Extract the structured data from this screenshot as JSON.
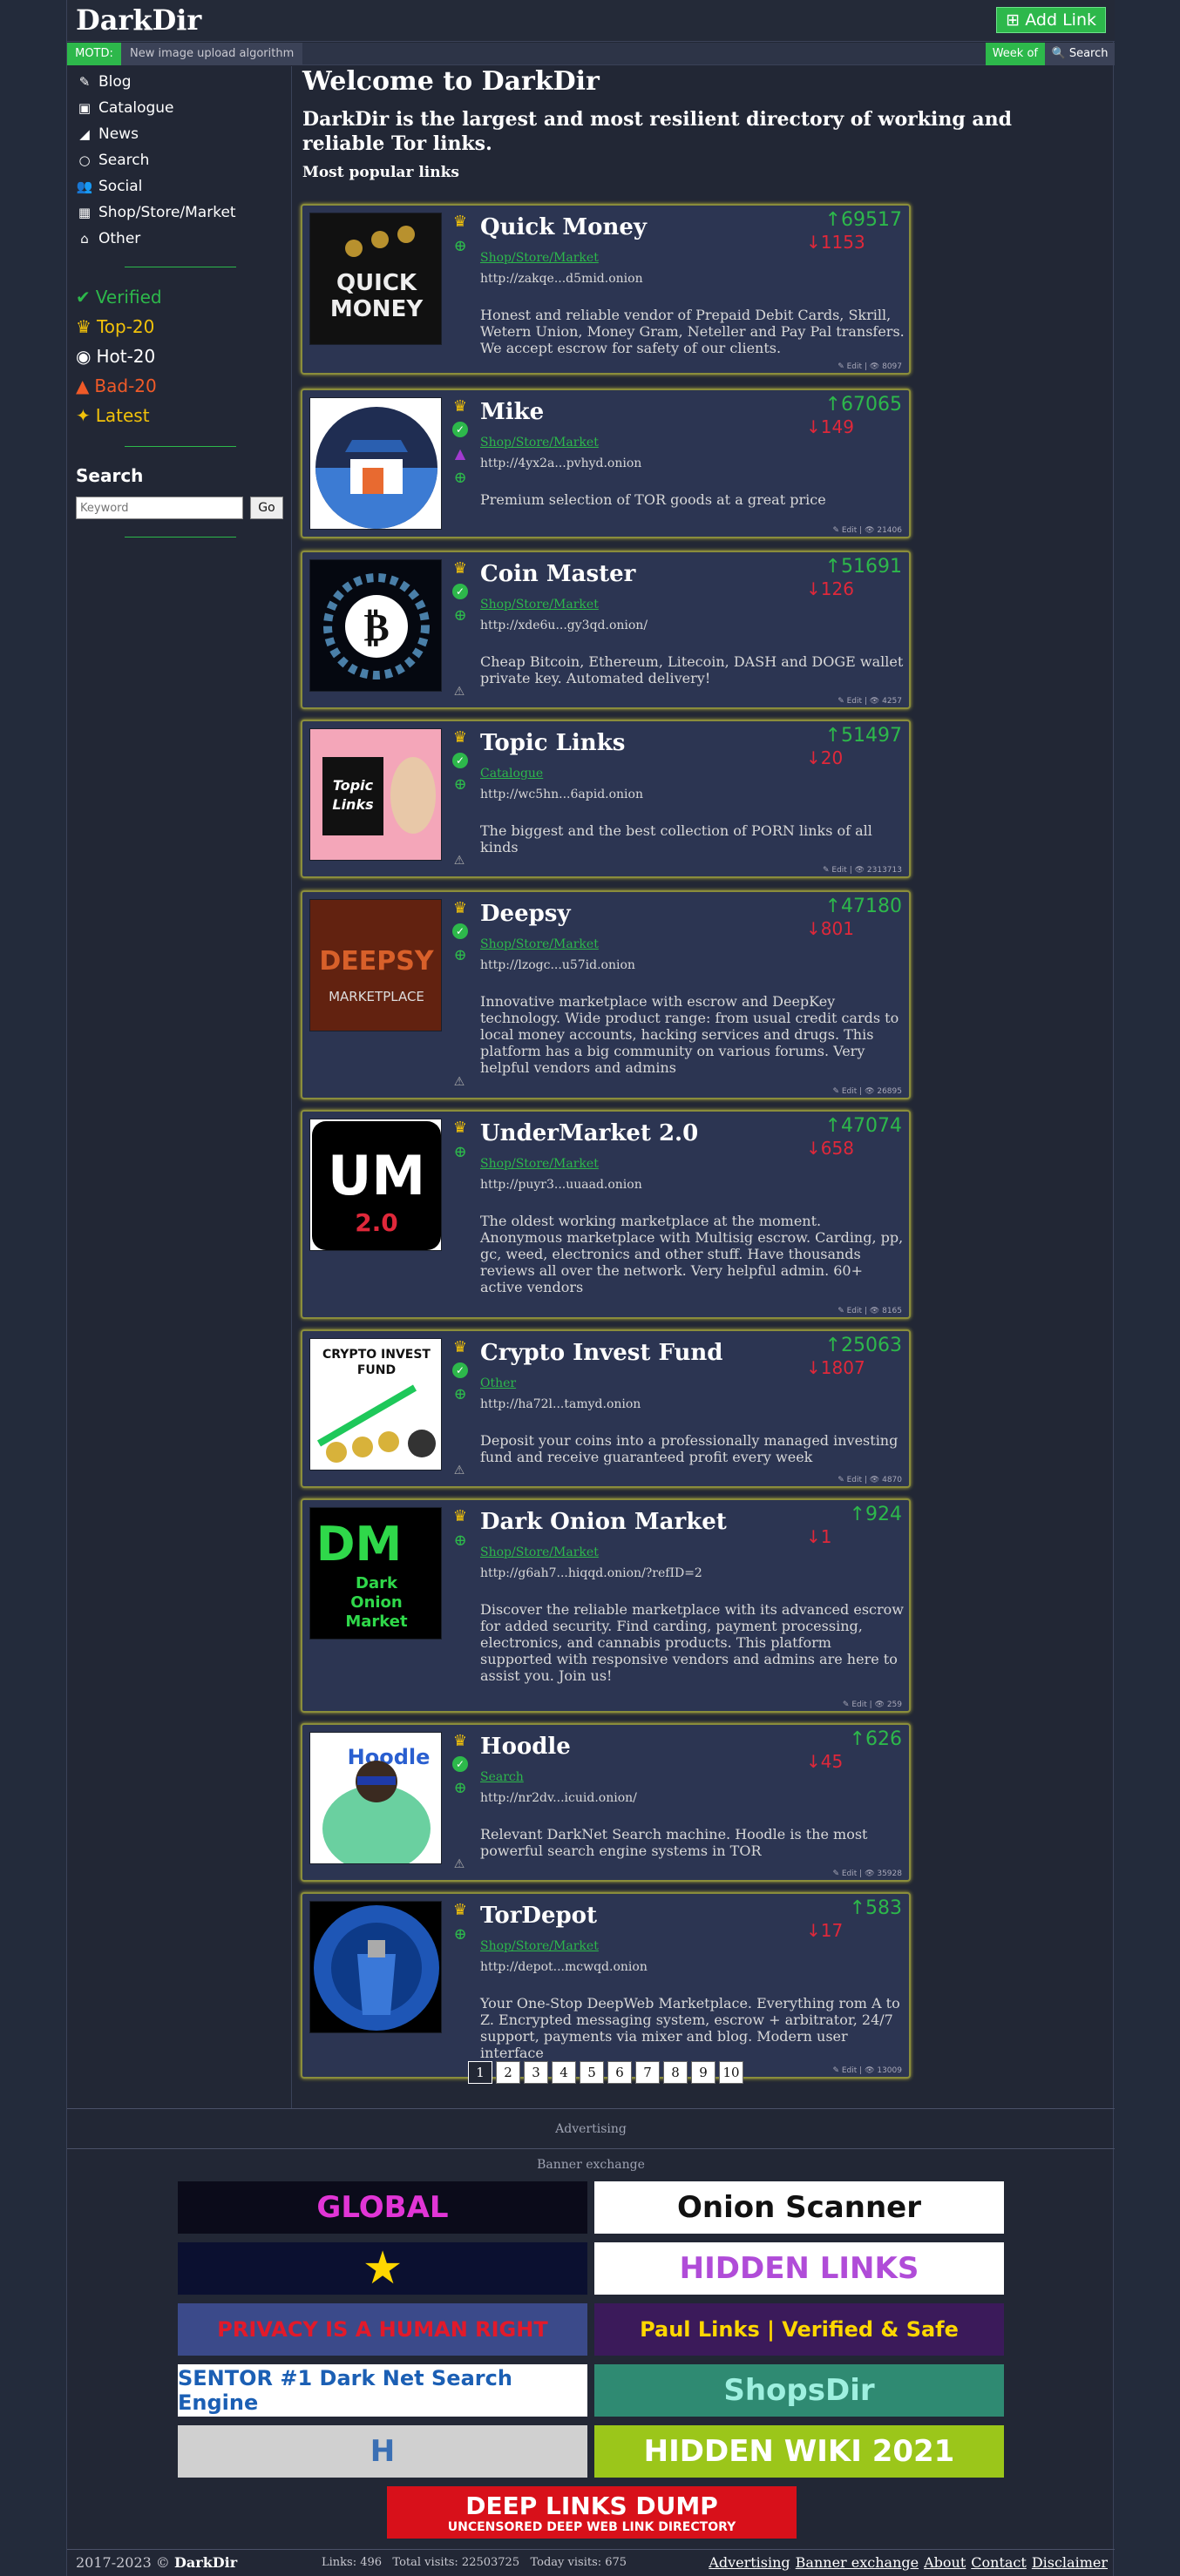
{
  "header": {
    "logo": "DarkDir",
    "add_link": "Add Link"
  },
  "motd": {
    "label": "MOTD:",
    "text": "New image upload algorithm",
    "week_of": "Week of",
    "search": "Search"
  },
  "sidebar": {
    "nav": [
      {
        "icon": "blog-icon",
        "label": "Blog"
      },
      {
        "icon": "catalogue-icon",
        "label": "Catalogue"
      },
      {
        "icon": "rss-icon",
        "label": "News"
      },
      {
        "icon": "search-icon",
        "label": "Search"
      },
      {
        "icon": "social-icon",
        "label": "Social"
      },
      {
        "icon": "store-icon",
        "label": "Shop/Store/Market"
      },
      {
        "icon": "other-icon",
        "label": "Other"
      }
    ],
    "filters": [
      {
        "icon": "check-circle-icon",
        "label": "Verified",
        "color": "#2db84b"
      },
      {
        "icon": "crown-icon",
        "label": "Top-20",
        "color": "#f2c20a"
      },
      {
        "icon": "fire-icon",
        "label": "Hot-20",
        "color": "#ffffff"
      },
      {
        "icon": "thumbs-down-icon",
        "label": "Bad-20",
        "color": "#f05a28"
      },
      {
        "icon": "sparkle-icon",
        "label": "Latest",
        "color": "#f2c20a"
      }
    ],
    "search_title": "Search",
    "search_placeholder": "Keyword",
    "go": "Go"
  },
  "main": {
    "welcome": "Welcome to DarkDir",
    "tagline": "DarkDir is the largest and most resilient directory of working and reliable Tor links.",
    "popular": "Most popular links",
    "edit": "Edit",
    "links": [
      {
        "title": "Quick Money",
        "category": "Shop/Store/Market",
        "url": "http://zakqe...d5mid.onion",
        "desc": "Honest and reliable vendor of Prepaid Debit Cards, Skrill, Wetern Union, Money Gram, Neteller and Pay Pal transfers. We accept escrow for safety of our clients.",
        "up": "69517",
        "down": "1153",
        "views": "8097",
        "badges": [
          "crown",
          "globe"
        ],
        "warn": false
      },
      {
        "title": "Mike",
        "category": "Shop/Store/Market",
        "url": "http://4yx2a...pvhyd.onion",
        "desc": "Premium selection of TOR goods at a great price",
        "up": "67065",
        "down": "149",
        "views": "21406",
        "badges": [
          "crown",
          "check",
          "bag",
          "globe"
        ],
        "warn": false
      },
      {
        "title": "Coin Master",
        "category": "Shop/Store/Market",
        "url": "http://xde6u...gy3qd.onion/",
        "desc": "Cheap Bitcoin, Ethereum, Litecoin, DASH and DOGE wallet private key. Automated delivery!",
        "up": "51691",
        "down": "126",
        "views": "4257",
        "badges": [
          "crown",
          "check",
          "globe"
        ],
        "warn": true
      },
      {
        "title": "Topic Links",
        "category": "Catalogue",
        "url": "http://wc5hn...6apid.onion",
        "desc": "The biggest and the best collection of PORN links of all kinds",
        "up": "51497",
        "down": "20",
        "views": "2313713",
        "badges": [
          "crown",
          "check",
          "globe"
        ],
        "warn": true
      },
      {
        "title": "Deepsy",
        "category": "Shop/Store/Market",
        "url": "http://lzogc...u57id.onion",
        "desc": "Innovative marketplace with escrow and DeepKey technology. Wide product range: from usual credit cards to local money accounts, hacking services and drugs. This platform has a big community on various forums. Very helpful vendors and admins",
        "up": "47180",
        "down": "801",
        "views": "26895",
        "badges": [
          "crown",
          "check",
          "globe"
        ],
        "warn": true
      },
      {
        "title": "UnderMarket 2.0",
        "category": "Shop/Store/Market",
        "url": "http://puyr3...uuaad.onion",
        "desc": "The oldest working marketplace at the moment. Anonymous marketplace with Multisig escrow. Carding, pp, gc, weed, electronics and other stuff. Have thousands reviews all over the network. Very helpful admin. 60+ active vendors",
        "up": "47074",
        "down": "658",
        "views": "8165",
        "badges": [
          "crown",
          "globe"
        ],
        "warn": false
      },
      {
        "title": "Crypto Invest Fund",
        "category": "Other",
        "url": "http://ha72l...tamyd.onion",
        "desc": "Deposit your coins into a professionally managed investing fund and receive guaranteed profit every week",
        "up": "25063",
        "down": "1807",
        "views": "4870",
        "badges": [
          "crown",
          "check",
          "globe"
        ],
        "warn": true
      },
      {
        "title": "Dark Onion Market",
        "category": "Shop/Store/Market",
        "url": "http://g6ah7...hiqqd.onion/?refID=2",
        "desc": "Discover the reliable marketplace with its advanced escrow for added security. Find carding, payment processing, electronics, and cannabis products. This platform supported with responsive vendors and admins are here to assist you. Join us!",
        "up": "924",
        "down": "1",
        "views": "259",
        "badges": [
          "crown",
          "globe"
        ],
        "warn": false
      },
      {
        "title": "Hoodle",
        "category": "Search",
        "url": "http://nr2dv...icuid.onion/",
        "desc": "Relevant DarkNet Search machine. Hoodle is the most powerful search engine systems in TOR",
        "up": "626",
        "down": "45",
        "views": "35928",
        "badges": [
          "crown",
          "check",
          "globe"
        ],
        "warn": true
      },
      {
        "title": "TorDepot",
        "category": "Shop/Store/Market",
        "url": "http://depot...mcwqd.onion",
        "desc": "Your One-Stop DeepWeb Marketplace. Everything rom A to Z. Encrypted messaging system, escrow + arbitrator, 24/7 support, payments via mixer and blog. Modern user interface",
        "up": "583",
        "down": "17",
        "views": "13009",
        "badges": [
          "crown",
          "globe"
        ],
        "warn": false
      }
    ],
    "pages": [
      "1",
      "2",
      "3",
      "4",
      "5",
      "6",
      "7",
      "8",
      "9",
      "10"
    ]
  },
  "advertising": "Advertising",
  "banner_exchange": "Banner exchange",
  "banners": [
    {
      "text": "GLOBAL",
      "bg": "#0b0b1a",
      "fg": "#e135d6"
    },
    {
      "text": "Onion  Scanner",
      "bg": "#ffffff",
      "fg": "#111111"
    },
    {
      "text": "★",
      "bg": "#0b1030",
      "fg": "#ffd700"
    },
    {
      "text": "HIDDEN LINKS",
      "bg": "#ffffff",
      "fg": "#b04cd8"
    },
    {
      "text": "PRIVACY IS A HUMAN RIGHT",
      "bg": "#3b4a8a",
      "fg": "#e21a2a"
    },
    {
      "text": "Paul Links | Verified & Safe",
      "bg": "#3b1a5a",
      "fg": "#ffd700"
    },
    {
      "text": "SENTOR  #1 Dark Net Search Engine",
      "bg": "#ffffff",
      "fg": "#1b5fb4"
    },
    {
      "text": "ShopsDir",
      "bg": "#2f8a72",
      "fg": "#9ef0e0"
    },
    {
      "text": "H",
      "bg": "#d0d0d0",
      "fg": "#3a6fb4"
    },
    {
      "text": "HIDDEN WIKI 2021",
      "bg": "#9bc61a",
      "fg": "#ffffff"
    },
    {
      "text": "DEEP LINKS DUMP",
      "bg": "#d8101a",
      "fg": "#ffffff"
    }
  ],
  "banner_sub": "UNCENSORED DEEP WEB LINK DIRECTORY",
  "footer": {
    "copyright": "2017-2023 ©",
    "brand": "DarkDir",
    "stats": "Links: 496   Total visits: 22503725   Today visits: 675",
    "links": [
      "Advertising",
      "Banner exchange",
      "About",
      "Contact",
      "Disclaimer"
    ]
  }
}
